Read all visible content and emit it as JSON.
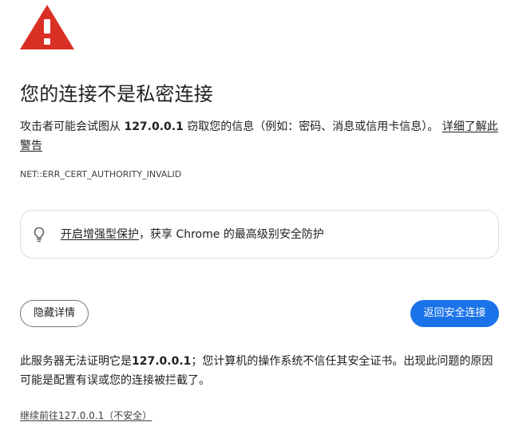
{
  "icons": {
    "warning": "warning-triangle-icon",
    "bulb": "lightbulb-icon"
  },
  "colors": {
    "warning_red": "#d93025",
    "primary_blue": "#1a73e8",
    "text": "#202124",
    "border": "#dadce0"
  },
  "heading": {
    "title": "您的连接不是私密连接"
  },
  "description": {
    "prefix": "攻击者可能会试图从 ",
    "host": "127.0.0.1",
    "suffix": " 窃取您的信息（例如：密码、消息或信用卡信息）。",
    "learn_more": "详细了解此警告"
  },
  "error": {
    "code": "NET::ERR_CERT_AUTHORITY_INVALID"
  },
  "enhanced_protection": {
    "link_text": "开启增强型保护",
    "rest_text": "，获享 Chrome 的最高级别安全防护"
  },
  "buttons": {
    "hide_details": "隐藏详情",
    "back_to_safety": "返回安全连接"
  },
  "details": {
    "prefix": "此服务器无法证明它是",
    "host": "127.0.0.1",
    "suffix": "；您计算机的操作系统不信任其安全证书。出现此问题的原因可能是配置有误或您的连接被拦截了。"
  },
  "proceed": {
    "link": "继续前往127.0.0.1（不安全）"
  }
}
